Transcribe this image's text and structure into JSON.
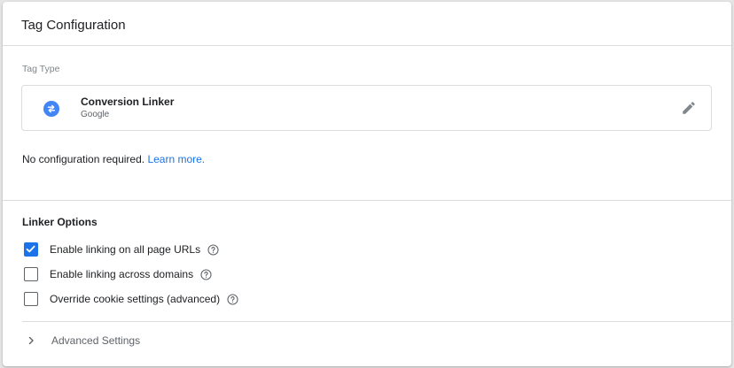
{
  "header": {
    "title": "Tag Configuration"
  },
  "tag_type": {
    "section_label": "Tag Type",
    "name": "Conversion Linker",
    "vendor": "Google",
    "icon": "conversion-linker-icon",
    "icon_color": "#4285f4"
  },
  "config_note": {
    "text": "No configuration required.",
    "link_label": "Learn more."
  },
  "linker_options": {
    "title": "Linker Options",
    "items": [
      {
        "label": "Enable linking on all page URLs",
        "checked": true
      },
      {
        "label": "Enable linking across domains",
        "checked": false
      },
      {
        "label": "Override cookie settings (advanced)",
        "checked": false
      }
    ]
  },
  "advanced": {
    "label": "Advanced Settings",
    "expanded": false
  },
  "colors": {
    "accent": "#1a73e8",
    "text": "#202124",
    "muted": "#5f6368",
    "divider": "#dadce0"
  }
}
